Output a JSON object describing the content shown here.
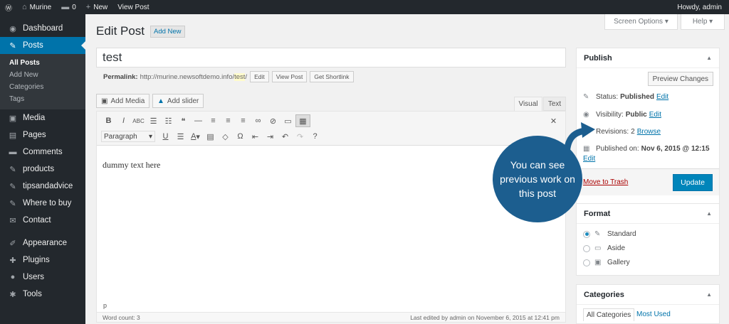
{
  "adminbar": {
    "site": "Murine",
    "comments": "0",
    "new": "New",
    "view": "View Post",
    "howdy": "Howdy, admin"
  },
  "menu": [
    {
      "label": "Dashboard",
      "icon": "dashboard-icon",
      "glyph": "◉"
    },
    {
      "label": "Posts",
      "icon": "pin-icon",
      "glyph": "✎",
      "active": true
    },
    {
      "label": "Media",
      "icon": "media-icon",
      "glyph": "▣"
    },
    {
      "label": "Pages",
      "icon": "pages-icon",
      "glyph": "▤"
    },
    {
      "label": "Comments",
      "icon": "comment-icon",
      "glyph": "▬"
    },
    {
      "label": "products",
      "icon": "pin-icon",
      "glyph": "✎"
    },
    {
      "label": "tipsandadvice",
      "icon": "pin-icon",
      "glyph": "✎"
    },
    {
      "label": "Where to buy",
      "icon": "pin-icon",
      "glyph": "✎"
    },
    {
      "label": "Contact",
      "icon": "mail-icon",
      "glyph": "✉"
    },
    {
      "label": "Appearance",
      "icon": "brush-icon",
      "glyph": "✐"
    },
    {
      "label": "Plugins",
      "icon": "plugin-icon",
      "glyph": "✚"
    },
    {
      "label": "Users",
      "icon": "user-icon",
      "glyph": "●"
    },
    {
      "label": "Tools",
      "icon": "wrench-icon",
      "glyph": "✱"
    }
  ],
  "submenu": [
    "All Posts",
    "Add New",
    "Categories",
    "Tags"
  ],
  "screen_options": "Screen Options ▾",
  "help": "Help ▾",
  "page_title": "Edit Post",
  "add_new": "Add New",
  "post_title": "test",
  "permalink": {
    "label": "Permalink:",
    "url": "http://murine.newsoftdemo.info/",
    "slug": "test",
    "tail": "/",
    "edit": "Edit",
    "view": "View Post",
    "shortlink": "Get Shortlink"
  },
  "add_media": "Add Media",
  "add_slider": "Add slider",
  "tab_visual": "Visual",
  "tab_text": "Text",
  "format_select": "Paragraph",
  "content": "dummy text here",
  "path": "p",
  "word_count": "Word count: 3",
  "last_edited": "Last edited by admin on November 6, 2015 at 12:41 pm",
  "publish": {
    "title": "Publish",
    "preview": "Preview Changes",
    "status_label": "Status:",
    "status": "Published",
    "edit": "Edit",
    "visibility_label": "Visibility:",
    "visibility": "Public",
    "revisions_label": "Revisions:",
    "revisions": "2",
    "browse": "Browse",
    "published_label": "Published on:",
    "published": "Nov 6, 2015 @ 12:15",
    "trash": "Move to Trash",
    "update": "Update"
  },
  "format": {
    "title": "Format",
    "options": [
      "Standard",
      "Aside",
      "Gallery"
    ],
    "selected": 0
  },
  "categories": {
    "title": "Categories",
    "tab_all": "All Categories",
    "tab_used": "Most Used"
  },
  "callout": "You can see previous work on this post",
  "colors": {
    "accent": "#0073aa",
    "callout": "#1c5e8f",
    "adminbar": "#23282d"
  }
}
